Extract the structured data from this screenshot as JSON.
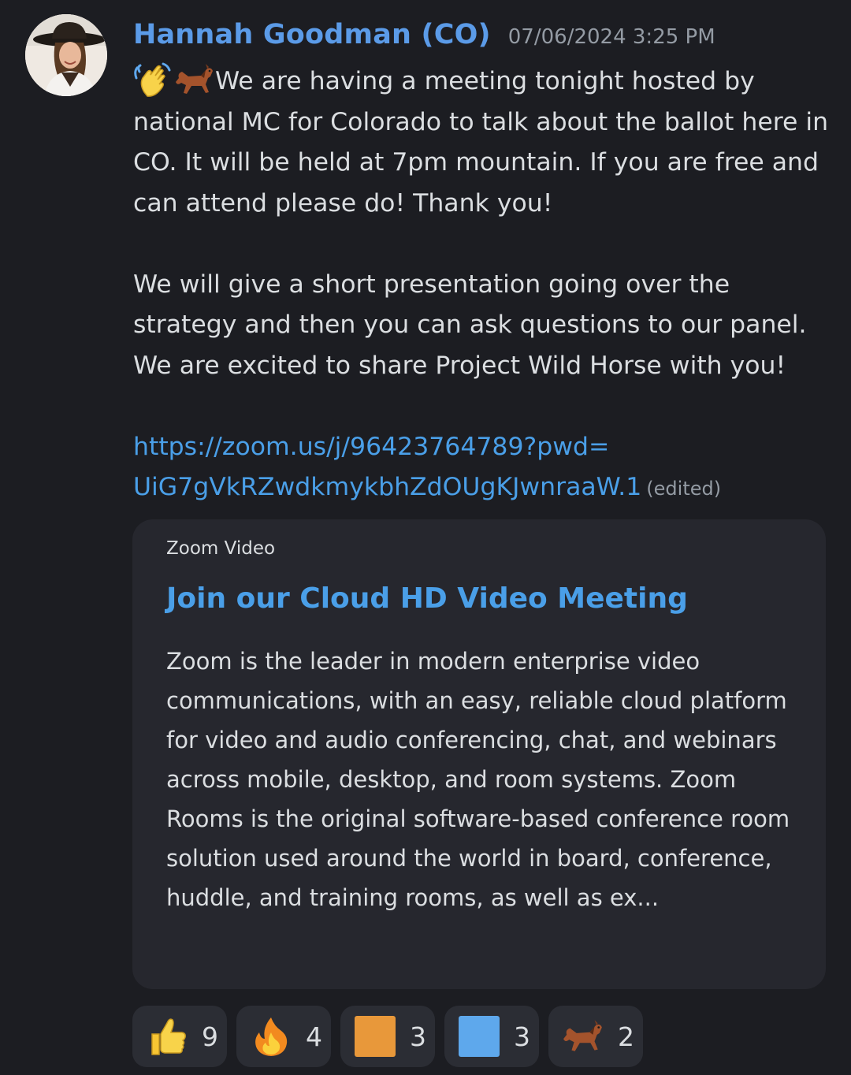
{
  "message": {
    "author": "Hannah Goodman (CO)",
    "timestamp": "07/06/2024 3:25 PM",
    "leading_emojis": [
      "waving-hand-icon",
      "horse-icon"
    ],
    "paragraph1": "We are having a meeting tonight hosted by national MC for Colorado to talk about the ballot here in CO. It will be held at 7pm mountain. If you are free and can attend please do! Thank you!",
    "paragraph2": "We will give a short presentation going over the strategy and  then you can ask questions to our panel. We are excited to share Project Wild Horse with you!",
    "link_line1": "https://zoom.us/j/96423764789?pwd=",
    "link_line2": "UiG7gVkRZwdkmykbhZdOUgKJwnraaW.1",
    "edited_label": "(edited)"
  },
  "embed": {
    "provider": "Zoom Video",
    "title": "Join our Cloud HD Video Meeting",
    "description": "Zoom is the leader in modern enterprise video communications, with an easy, reliable cloud platform for video and audio conferencing, chat, and webinars across mobile, desktop, and room systems. Zoom Rooms is the original software-based conference room solution used around the world in board, conference, huddle, and training rooms, as well as ex..."
  },
  "reactions": [
    {
      "icon": "thumbs-up-icon",
      "count": "9"
    },
    {
      "icon": "fire-icon",
      "count": "4"
    },
    {
      "icon": "orange-square-icon",
      "count": "3",
      "color": "#e8983a"
    },
    {
      "icon": "blue-square-icon",
      "count": "3",
      "color": "#5ea8ec"
    },
    {
      "icon": "horse-icon",
      "count": "2"
    }
  ],
  "colors": {
    "background": "#1c1d22",
    "author": "#5b9be8",
    "link": "#4a9fe8",
    "embed_bg": "#26272e",
    "reaction_bg": "#2b2d34"
  }
}
